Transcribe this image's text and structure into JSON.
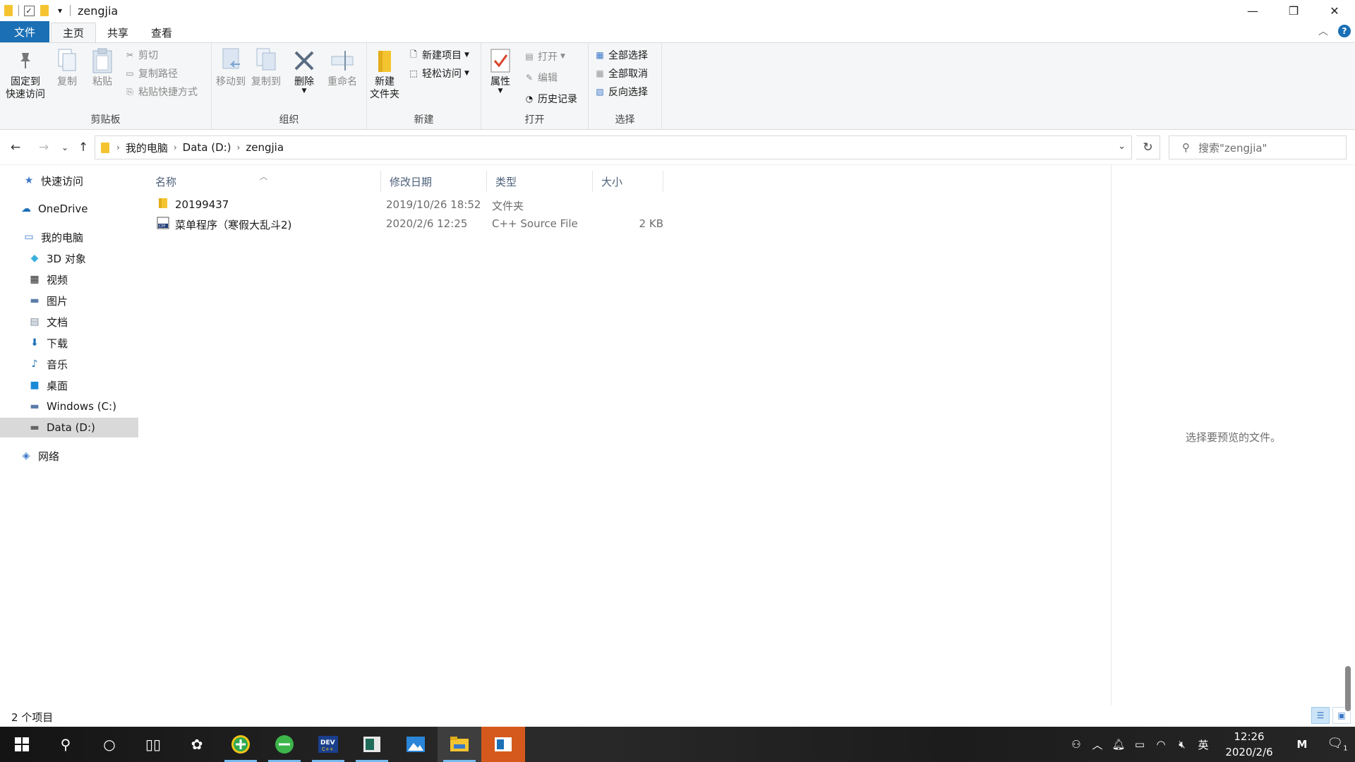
{
  "window": {
    "title": "zengjia",
    "controls": {
      "minimize": "—",
      "restore": "❐",
      "close": "✕"
    }
  },
  "ribbon_tabs": [
    "文件",
    "主页",
    "共享",
    "查看"
  ],
  "ribbon": {
    "clipboard": {
      "label": "剪贴板",
      "pin": [
        "固定到",
        "快速访问"
      ],
      "copy": "复制",
      "paste": "粘贴",
      "cut": "剪切",
      "copy_path": "复制路径",
      "paste_shortcut": "粘贴快捷方式"
    },
    "organize": {
      "label": "组织",
      "move_to": "移动到",
      "copy_to": "复制到",
      "delete": "删除",
      "rename": "重命名"
    },
    "new": {
      "label": "新建",
      "new_folder": [
        "新建",
        "文件夹"
      ],
      "new_item": "新建项目",
      "easy_access": "轻松访问"
    },
    "open": {
      "label": "打开",
      "properties": "属性",
      "open": "打开",
      "edit": "编辑",
      "history": "历史记录"
    },
    "select": {
      "label": "选择",
      "select_all": "全部选择",
      "select_none": "全部取消",
      "invert": "反向选择"
    }
  },
  "address": {
    "crumbs": [
      "我的电脑",
      "Data (D:)",
      "zengjia"
    ],
    "search_placeholder": "搜索\"zengjia\""
  },
  "nav": {
    "quick_access": "快速访问",
    "onedrive": "OneDrive",
    "this_pc": "我的电脑",
    "objects3d": "3D 对象",
    "videos": "视频",
    "pictures": "图片",
    "documents": "文档",
    "downloads": "下载",
    "music": "音乐",
    "desktop": "桌面",
    "drive_c": "Windows (C:)",
    "drive_d": "Data (D:)",
    "network": "网络"
  },
  "columns": {
    "name": "名称",
    "date": "修改日期",
    "type": "类型",
    "size": "大小"
  },
  "files": [
    {
      "name": "20199437",
      "date": "2019/10/26 18:52",
      "type": "文件夹",
      "size": ""
    },
    {
      "name": "菜单程序（寒假大乱斗2)",
      "date": "2020/2/6 12:25",
      "type": "C++ Source File",
      "size": "2 KB"
    }
  ],
  "preview_message": "选择要预览的文件。",
  "status": {
    "count": "2 个项目"
  },
  "taskbar": {
    "tray_lang": "英",
    "time": "12:26",
    "date": "2020/2/6",
    "notification_count": "1"
  },
  "colors": {
    "accent": "#1a6fb5",
    "folder": "#f4c430",
    "active_task": "#d5591c"
  }
}
